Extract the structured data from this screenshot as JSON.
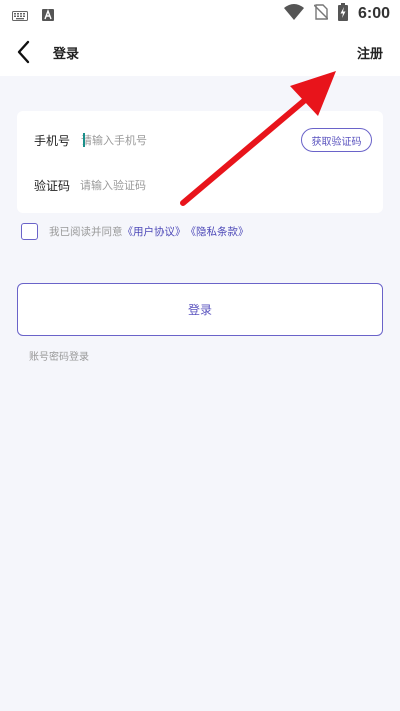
{
  "status_bar": {
    "time": "6:00",
    "icons": [
      "keyboard-icon",
      "a-notification-icon",
      "wifi-icon",
      "no-sim-icon",
      "battery-charging-icon"
    ]
  },
  "nav": {
    "title": "登录",
    "register_label": "注册"
  },
  "form": {
    "phone_label": "手机号",
    "phone_placeholder": "请输入手机号",
    "get_code_label": "获取验证码",
    "code_label": "验证码",
    "code_placeholder": "请输入验证码"
  },
  "agreement": {
    "text": "我已阅读并同意",
    "user_agreement": "《用户协议》",
    "privacy_policy": "《隐私条款》"
  },
  "login_button_label": "登录",
  "password_login_label": "账号密码登录",
  "colors": {
    "accent": "#6a63c9",
    "annotation_arrow": "#e8141b",
    "background": "#f5f6fb"
  }
}
